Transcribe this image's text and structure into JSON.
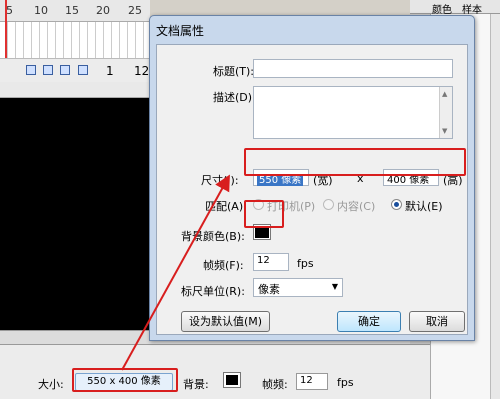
{
  "timeline": {
    "ruler_ticks": [
      "5",
      "10",
      "15",
      "20",
      "25"
    ],
    "frame_numbers": [
      "1",
      "12"
    ]
  },
  "right_panel": {
    "tabs": [
      "颜色",
      "样本"
    ]
  },
  "properties": {
    "size_label": "大小:",
    "size_button": "550 x 400 像素",
    "bg_label": "背景:",
    "fps_label": "帧频:",
    "fps_value": "12",
    "fps_unit": "fps"
  },
  "dialog": {
    "title": "文档属性",
    "title_label": "标题(T):",
    "title_value": "",
    "desc_label": "描述(D):",
    "desc_value": "",
    "size_label": "尺寸(I):",
    "width_value": "550 像素",
    "width_suffix": "(宽)",
    "times": "x",
    "height_value": "400 像素",
    "height_suffix": "(高)",
    "match_label": "匹配(A):",
    "match_printer": "打印机(P)",
    "match_contents": "内容(C)",
    "match_default": "默认(E)",
    "bg_color_label": "背景颜色(B):",
    "frame_rate_label": "帧频(F):",
    "frame_rate_value": "12",
    "frame_rate_unit": "fps",
    "ruler_units_label": "标尺单位(R):",
    "ruler_units_value": "像素",
    "make_default_button": "设为默认值(M)",
    "ok_button": "确定",
    "cancel_button": "取消"
  },
  "colors": {
    "annotation_red": "#d81e1e",
    "stage_background": "#000000",
    "selection_blue": "#3a76c6"
  }
}
